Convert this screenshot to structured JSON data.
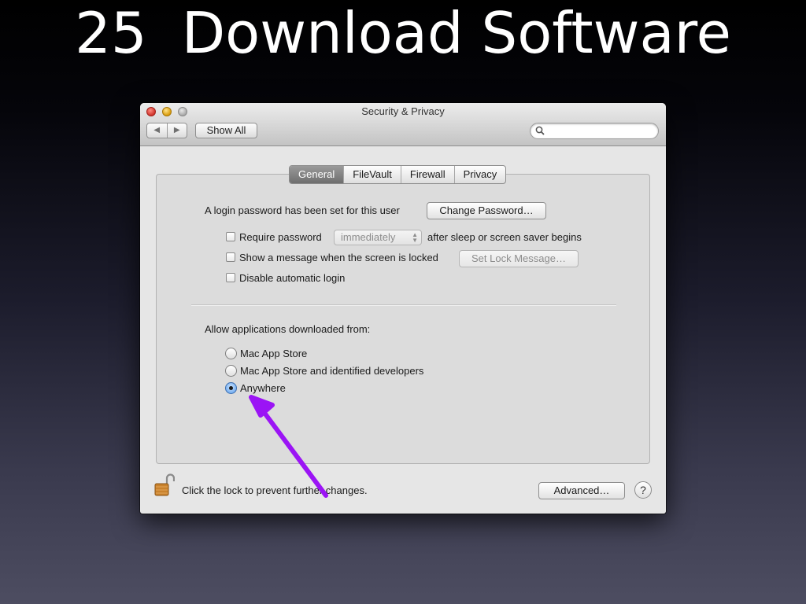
{
  "slide": {
    "number": "25",
    "title": "Download Software"
  },
  "window": {
    "title": "Security & Privacy",
    "nav": {
      "back_icon": "◀",
      "forward_icon": "▶"
    },
    "show_all": "Show All",
    "search": {
      "placeholder": "",
      "value": ""
    }
  },
  "tabs": [
    "General",
    "FileVault",
    "Firewall",
    "Privacy"
  ],
  "active_tab": "General",
  "general": {
    "login_password_text": "A login password has been set for this user",
    "change_password_button": "Change Password…",
    "require_password": {
      "label": "Require password",
      "checked": false,
      "select_value": "immediately",
      "suffix": "after sleep or screen saver begins"
    },
    "show_message": {
      "label": "Show a message when the screen is locked",
      "checked": false,
      "button": "Set Lock Message…"
    },
    "disable_auto_login": {
      "label": "Disable automatic login",
      "checked": false
    },
    "allow_heading": "Allow applications downloaded from:",
    "allow_options": [
      {
        "label": "Mac App Store",
        "selected": false
      },
      {
        "label": "Mac App Store and identified developers",
        "selected": false
      },
      {
        "label": "Anywhere",
        "selected": true
      }
    ]
  },
  "footer": {
    "lock_icon": "open-padlock",
    "lock_text": "Click the lock to prevent further changes.",
    "advanced_button": "Advanced…",
    "help_button": "?"
  },
  "colors": {
    "annotation_arrow": "#9b14f5",
    "active_tab_bg": "#7a7a7a",
    "radio_selected": "#6da9ef"
  }
}
